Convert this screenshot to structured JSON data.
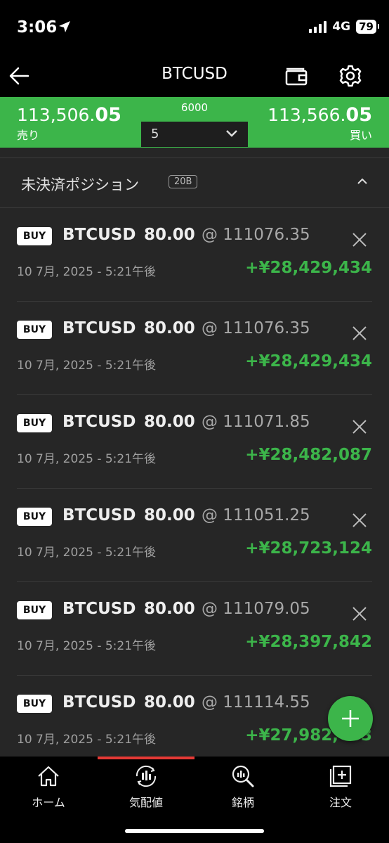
{
  "status_bar": {
    "time": "3:06",
    "network": "4G",
    "battery": "79"
  },
  "header": {
    "title": "BTCUSD"
  },
  "quote": {
    "sell_price_main": "113,506.",
    "sell_price_fraction": "05",
    "sell_label": "売り",
    "buy_price_main": "113,566.",
    "buy_price_fraction": "05",
    "buy_label": "買い",
    "spread": "6000",
    "lot": "5"
  },
  "positions_section": {
    "title": "未決済ポジション",
    "badge": "20B"
  },
  "positions": [
    {
      "side": "BUY",
      "symbol": "BTCUSD",
      "volume": "80.00",
      "price": "@ 111076.35",
      "date": "10 7月, 2025 - 5:21午後",
      "pl": "+¥28,429,434"
    },
    {
      "side": "BUY",
      "symbol": "BTCUSD",
      "volume": "80.00",
      "price": "@ 111076.35",
      "date": "10 7月, 2025 - 5:21午後",
      "pl": "+¥28,429,434"
    },
    {
      "side": "BUY",
      "symbol": "BTCUSD",
      "volume": "80.00",
      "price": "@ 111071.85",
      "date": "10 7月, 2025 - 5:21午後",
      "pl": "+¥28,482,087"
    },
    {
      "side": "BUY",
      "symbol": "BTCUSD",
      "volume": "80.00",
      "price": "@ 111051.25",
      "date": "10 7月, 2025 - 5:21午後",
      "pl": "+¥28,723,124"
    },
    {
      "side": "BUY",
      "symbol": "BTCUSD",
      "volume": "80.00",
      "price": "@ 111079.05",
      "date": "10 7月, 2025 - 5:21午後",
      "pl": "+¥28,397,842"
    },
    {
      "side": "BUY",
      "symbol": "BTCUSD",
      "volume": "80.00",
      "price": "@ 111114.55",
      "date": "10 7月, 2025 - 5:21午後",
      "pl": "+¥27,982,403"
    }
  ],
  "tabs": [
    {
      "label": "ホーム",
      "icon": "home-icon"
    },
    {
      "label": "気配値",
      "icon": "quotes-icon"
    },
    {
      "label": "銘柄",
      "icon": "symbol-search-icon"
    },
    {
      "label": "注文",
      "icon": "order-icon"
    }
  ],
  "colors": {
    "accent_green": "#3cb54a",
    "active_tab_red": "#e53935",
    "panel_bg": "#262626"
  }
}
